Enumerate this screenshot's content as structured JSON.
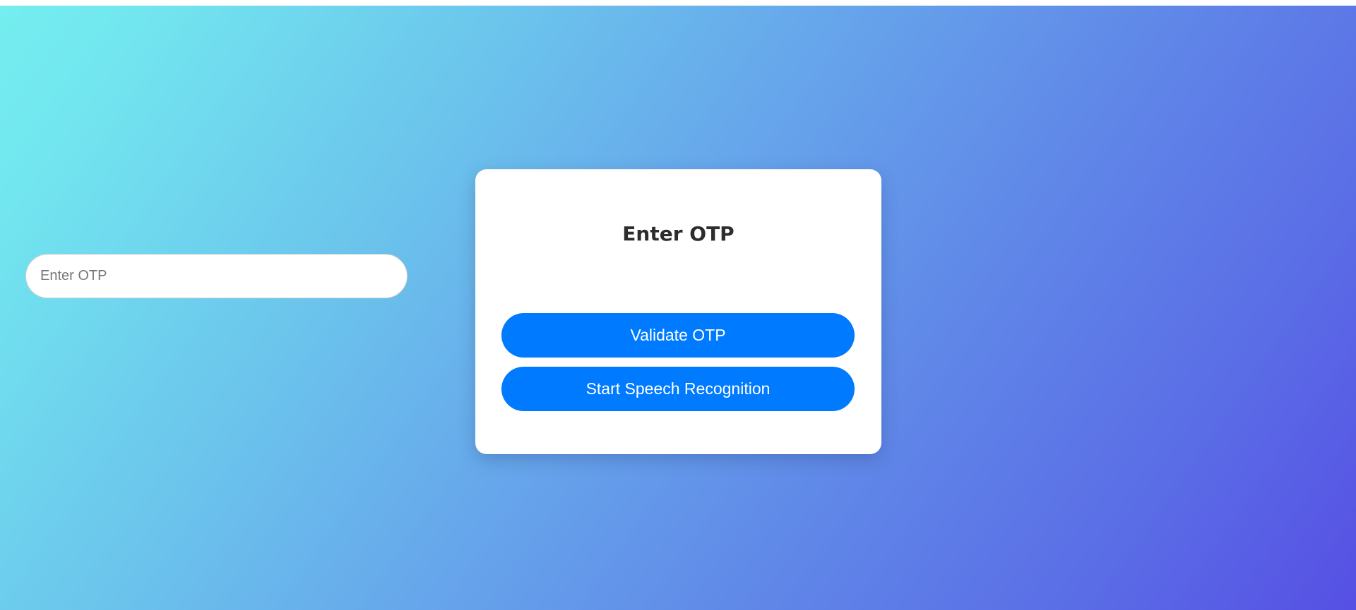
{
  "otp_form": {
    "title": "Enter OTP",
    "input_placeholder": "Enter OTP",
    "input_value": "",
    "validate_label": "Validate OTP",
    "speech_label": "Start Speech Recognition"
  },
  "colors": {
    "gradient_start": "#74eeef",
    "gradient_end": "#5650e4",
    "button": "#007bff",
    "card": "#ffffff",
    "title_text": "#2d2d2d"
  }
}
